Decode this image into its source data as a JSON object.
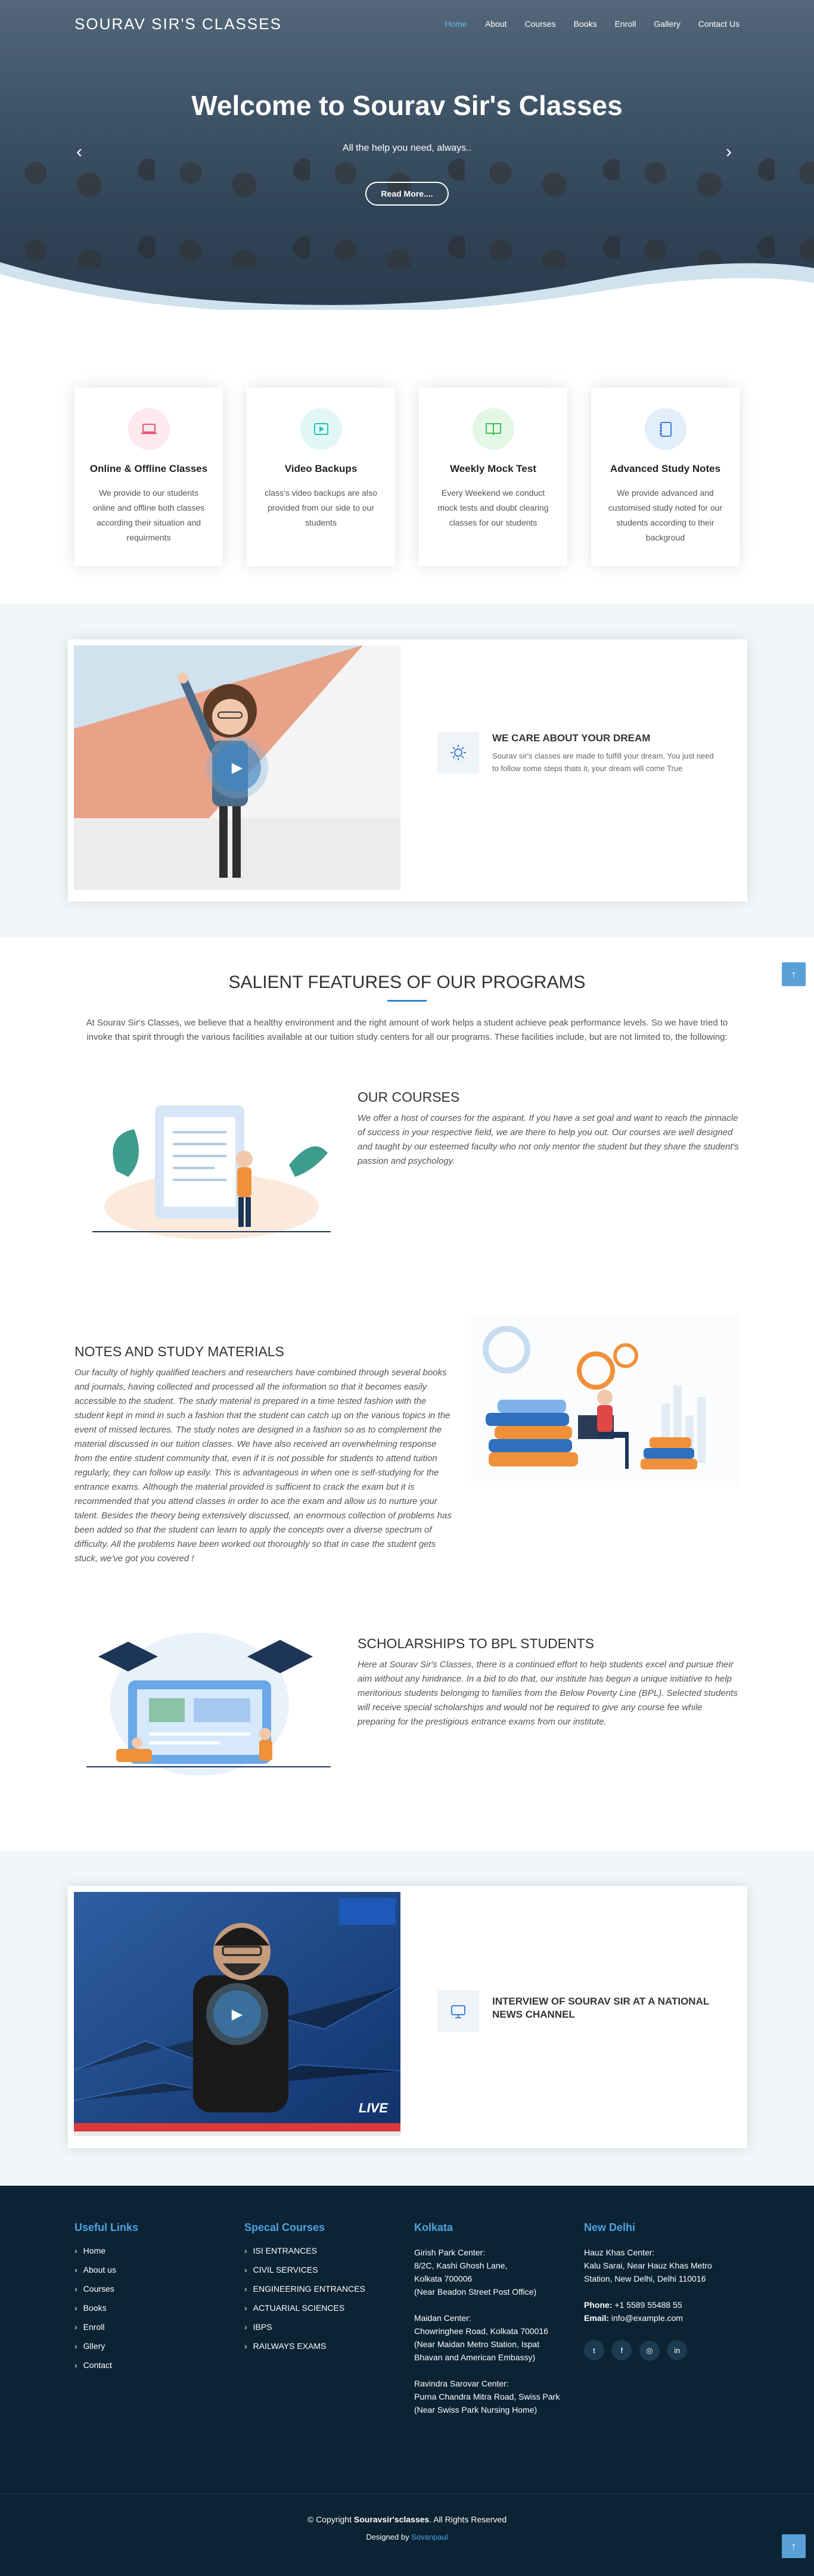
{
  "nav": {
    "logo": "SOURAV SIR'S CLASSES",
    "items": [
      "Home",
      "About",
      "Courses",
      "Books",
      "Enroll",
      "Gallery",
      "Contact Us"
    ]
  },
  "hero": {
    "title": "Welcome to Sourav Sir's Classes",
    "subtitle": "All the help you need, always..",
    "button": "Read More....",
    "prev": "‹",
    "next": "›"
  },
  "cards": [
    {
      "title": "Online & Offline Classes",
      "text": "We provide to our students online and offline both classes according their situation and requirments",
      "icon": "laptop-icon",
      "color": "#e8557a",
      "bg": "#fde9ee"
    },
    {
      "title": "Video Backups",
      "text": "class's video backups are also provided from our side to our students",
      "icon": "video-icon",
      "color": "#24c1b5",
      "bg": "#e1f7f5"
    },
    {
      "title": "Weekly Mock Test",
      "text": "Every Weekend we conduct mock tests and doubt clearing classes for our students",
      "icon": "book-icon",
      "color": "#3fbf55",
      "bg": "#e4f7e7"
    },
    {
      "title": "Advanced Study Notes",
      "text": "We provide advanced and customised study noted for our students according to their backgroud",
      "icon": "notes-icon",
      "color": "#3e7fd6",
      "bg": "#e3eefb"
    }
  ],
  "dream": {
    "title": "WE CARE ABOUT YOUR DREAM",
    "text": "Sourav sir's classes are made to fulfill your dream. You just need to follow some steps thats it, your dream will come True"
  },
  "salient": {
    "title": "SALIENT FEATURES OF OUR PROGRAMS",
    "intro": "At Sourav Sir's Classes, we believe that a healthy environment and the right amount of work helps a student achieve peak performance levels. So we have tried to invoke that spirit through the various facilities available at our tuition study centers for all our programs. These facilities include, but are not limited to, the following:",
    "courses_title": "OUR COURSES",
    "courses_text": "We offer a host of courses for the aspirant. If you have a set goal and want to reach the pinnacle of success in your respective field, we are there to help you out. Our courses are well designed and taught by our esteemed faculty who not only mentor the student but they share the student's passion and psychology.",
    "notes_title": "NOTES AND STUDY MATERIALS",
    "notes_text": "Our faculty of highly qualified teachers and researchers have combined through several books and journals, having collected and processed all the information so that it becomes easily accessible to the student. The study material is prepared in a time tested fashion with the student kept in mind in such a fashion that the student can catch up on the various topics in the event of missed lectures. The study notes are designed in a fashion so as to complement the material discussed in our tuition classes. We have also received an overwhelming response from the entire student community that, even if it is not possible for students to attend tuition regularly, they can follow up easily. This is advantageous in when one is self-studying for the entrance exams. Although the material provided is sufficient to crack the exam but it is recommended that you attend classes in order to ace the exam and allow us to nurture your talent. Besides the theory being extensively discussed, an enormous collection of problems has been added so that the student can learn to apply the concepts over a diverse spectrum of difficulty. All the problems have been worked out thoroughly so that in case the student gets stuck, we've got you covered !",
    "bpl_title": "SCHOLARSHIPS TO BPL STUDENTS",
    "bpl_text": "Here at Sourav Sir's Classes, there is a continued effort to help students excel and pursue their aim without any hindrance. In a bid to do that, our institute has begun a unique initiative to help meritorious students belonging to families from the Below Poverty Line (BPL). Selected students will receive special scholarships and would not be required to give any course fee while preparing for the prestigious entrance exams from our institute."
  },
  "interview": {
    "title": "INTERVIEW OF SOURAV SIR AT A NATIONAL NEWS CHANNEL",
    "live": "LIVE"
  },
  "footer": {
    "useful_title": "Useful Links",
    "useful": [
      "Home",
      "About us",
      "Courses",
      "Books",
      "Enroll",
      "Gllery",
      "Contact"
    ],
    "special_title": "Specal Courses",
    "special": [
      "ISI ENTRANCES",
      "CIVIL SERVICES",
      "ENGINEERING ENTRANCES",
      "ACTUARIAL SCIENCES",
      "IBPS",
      "RAILWAYS EXAMS"
    ],
    "kolkata_title": "Kolkata",
    "kolkata": [
      "Girish Park Center:",
      "8/2C, Kashi Ghosh Lane,",
      "Kolkata 700006",
      "(Near Beadon Street Post Office)",
      "Maidan Center:",
      "Chowringhee Road, Kolkata 700016",
      "(Near Maidan Metro Station, Ispat",
      "Bhavan and American Embassy)",
      "Ravindra Sarovar Center:",
      "Purna Chandra Mitra Road, Swiss Park",
      "(Near Swiss Park Nursing Home)"
    ],
    "delhi_title": "New Delhi",
    "delhi": [
      "Hauz Khas Center:",
      "Kalu Sarai, Near Hauz Khas Metro",
      "Station, New Delhi, Delhi 110016"
    ],
    "phone_label": "Phone:",
    "phone": "+1 5589 55488 55",
    "email_label": "Email:",
    "email": "info@example.com",
    "social": [
      "t",
      "f",
      "◎",
      "in"
    ],
    "copyright_pre": "© Copyright",
    "copyright_brand": "Souravsir'sclasses",
    "copyright_post": ". All Rights Reserved",
    "designed_by": "Designed by",
    "designer": "Sovanpaul"
  }
}
